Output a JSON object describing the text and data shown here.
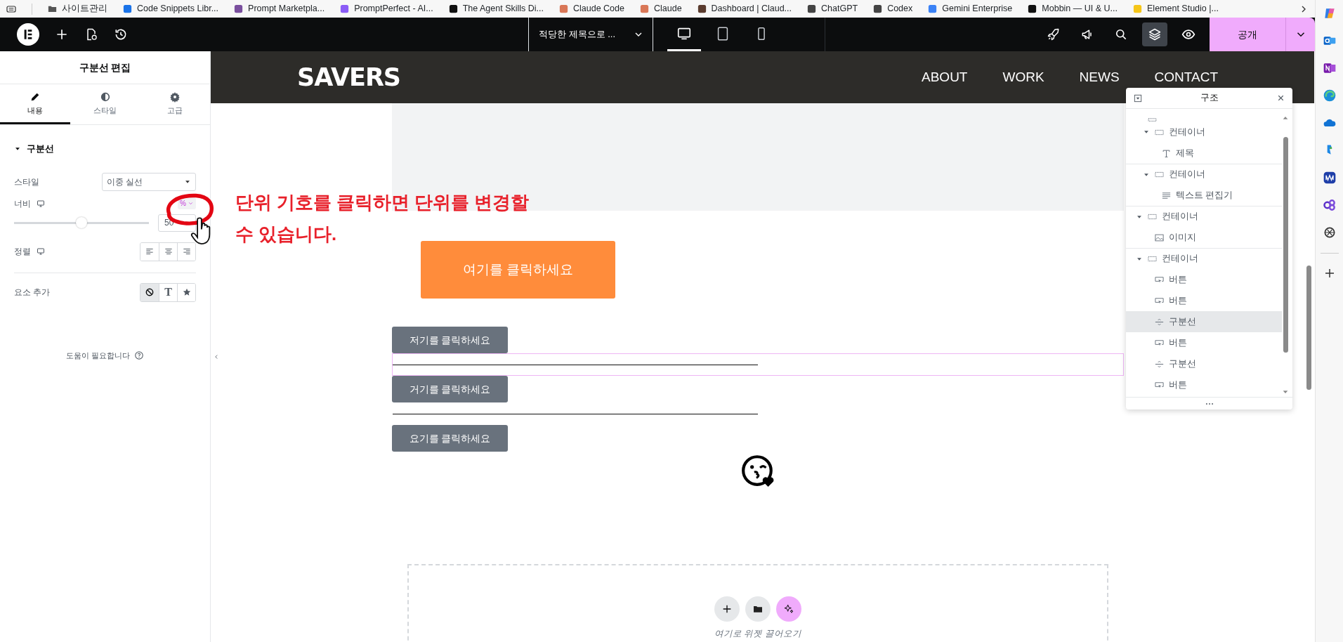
{
  "bookmarks": {
    "items": [
      {
        "label": "사이트관리",
        "kind": "folder",
        "color": "#555555"
      },
      {
        "label": "Code Snippets Libr...",
        "kind": "site",
        "color": "#1a73e8"
      },
      {
        "label": "Prompt Marketpla...",
        "kind": "site",
        "color": "#7a4f9e"
      },
      {
        "label": "PromptPerfect - AI...",
        "kind": "site",
        "color": "#8b5cf6"
      },
      {
        "label": "The Agent Skills Di...",
        "kind": "site",
        "color": "#111111"
      },
      {
        "label": "Claude Code",
        "kind": "site",
        "color": "#d97757"
      },
      {
        "label": "Claude",
        "kind": "site",
        "color": "#d97757"
      },
      {
        "label": "Dashboard | Claud...",
        "kind": "site",
        "color": "#5a3b2e"
      },
      {
        "label": "ChatGPT",
        "kind": "site",
        "color": "#444444"
      },
      {
        "label": "Codex",
        "kind": "site",
        "color": "#444444"
      },
      {
        "label": "Gemini Enterprise",
        "kind": "site",
        "color": "#3b82f6"
      },
      {
        "label": "Mobbin — UI & U...",
        "kind": "site",
        "color": "#111111"
      },
      {
        "label": "Element Studio |...",
        "kind": "site",
        "color": "#f5c518"
      }
    ]
  },
  "toolbar": {
    "page_title": "적당한 제목으로 ...",
    "devices": [
      {
        "kind": "desktop",
        "selected": true
      },
      {
        "kind": "tablet",
        "selected": false
      },
      {
        "kind": "mobile",
        "selected": false
      }
    ],
    "tools": [
      {
        "kind": "rocket",
        "selected": false
      },
      {
        "kind": "megaphone",
        "selected": false
      },
      {
        "kind": "search",
        "selected": false
      },
      {
        "kind": "layers",
        "selected": true
      },
      {
        "kind": "eye",
        "selected": false
      }
    ],
    "publish_button": "공개"
  },
  "panel": {
    "title": "구분선 편집",
    "tabs": [
      {
        "label": "내용",
        "kind": "content",
        "selected": true
      },
      {
        "label": "스타일",
        "kind": "style",
        "selected": false
      },
      {
        "label": "고급",
        "kind": "advanced",
        "selected": false
      }
    ],
    "section": {
      "title": "구분선",
      "expanded": true
    },
    "style_field": {
      "label": "스타일",
      "value": "이중 실선"
    },
    "width": {
      "label": "너비",
      "unit": "%",
      "level": 0.5,
      "value": "50"
    },
    "alignment": {
      "label": "정렬",
      "options": [
        {
          "kind": "left",
          "selected": false
        },
        {
          "kind": "center",
          "selected": false
        },
        {
          "kind": "right",
          "selected": false
        }
      ]
    },
    "add_element": {
      "label": "요소 추가",
      "options": [
        {
          "kind": "none",
          "selected": true
        },
        {
          "kind": "text",
          "label": "T",
          "selected": false
        },
        {
          "kind": "icon",
          "selected": false
        }
      ]
    },
    "help": "도움이 필요합니다"
  },
  "annotation": {
    "text": "단위 기호를 클릭하면 단위를 변경할 수 있습니다."
  },
  "site": {
    "logo": "SAVERS",
    "nav": [
      "ABOUT",
      "WORK",
      "NEWS",
      "CONTACT"
    ],
    "hero_button": "여기를 클릭하세요",
    "elements": [
      {
        "kind": "button",
        "label": "저기를 클릭하세요",
        "selected": false
      },
      {
        "kind": "divider",
        "selected": true
      },
      {
        "kind": "button",
        "label": "거기를 클릭하세요",
        "selected": false
      },
      {
        "kind": "divider",
        "selected": false
      },
      {
        "kind": "button",
        "label": "요기를 클릭하세요",
        "selected": false
      }
    ],
    "drop_zone": {
      "hint": "여기로 위젯 끌어오기"
    }
  },
  "structure": {
    "title": "구조",
    "tree": [
      {
        "kind": "clipped",
        "children": [
          {
            "label": "컨테이너",
            "kind": "container",
            "expanded": true,
            "selected": false,
            "children": [
              {
                "label": "제목",
                "kind": "heading",
                "selected": false
              }
            ]
          },
          {
            "label": "컨테이너",
            "kind": "container",
            "expanded": true,
            "selected": false,
            "children": [
              {
                "label": "텍스트 편집기",
                "kind": "text-editor",
                "selected": false
              }
            ]
          }
        ]
      },
      {
        "label": "컨테이너",
        "kind": "container",
        "expanded": true,
        "selected": false,
        "children": [
          {
            "label": "이미지",
            "kind": "image",
            "selected": false
          }
        ]
      },
      {
        "label": "컨테이너",
        "kind": "container",
        "expanded": true,
        "selected": false,
        "children": [
          {
            "label": "버튼",
            "kind": "button",
            "selected": false
          },
          {
            "label": "버튼",
            "kind": "button",
            "selected": false
          },
          {
            "label": "구분선",
            "kind": "divider",
            "selected": true
          },
          {
            "label": "버튼",
            "kind": "button",
            "selected": false
          },
          {
            "label": "구분선",
            "kind": "divider",
            "selected": false
          },
          {
            "label": "버튼",
            "kind": "button",
            "selected": false
          }
        ]
      }
    ]
  }
}
